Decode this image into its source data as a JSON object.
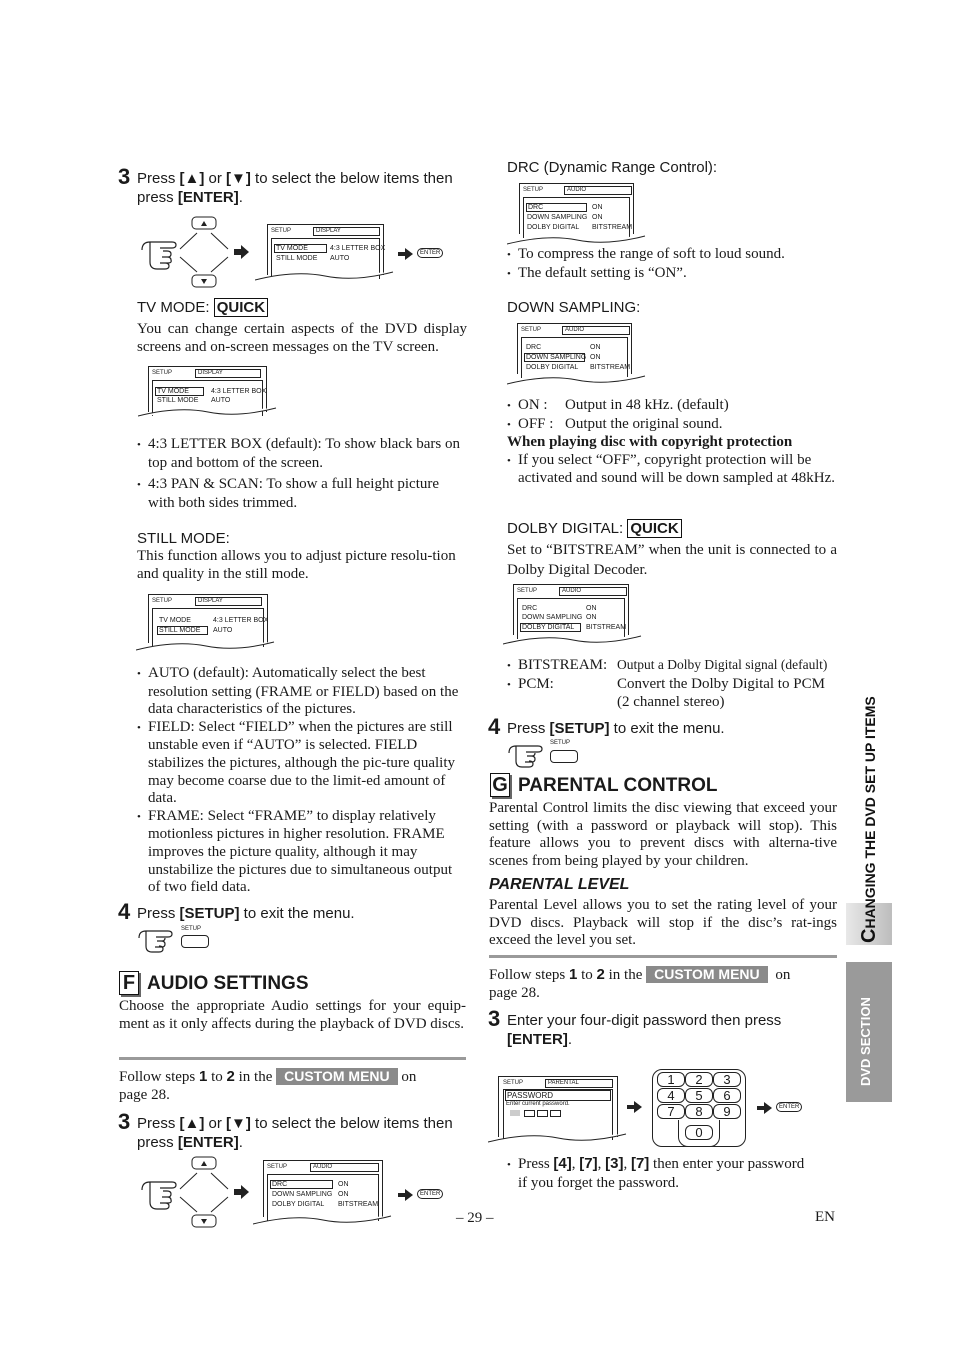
{
  "left_column": {
    "step3_top": {
      "number": "3",
      "text_pre": "Press ",
      "up_key": "[▲]",
      "mid": " or ",
      "down_key": "[▼]",
      "text_post": " to select the below items then",
      "line2_pre": "press ",
      "enter_key": "[ENTER]",
      "line2_post": "."
    },
    "osd_display_1": {
      "setup": "SETUP",
      "tab": "DISPLAY",
      "rows": [
        {
          "label": "TV MODE",
          "value": "4:3 LETTER BOX"
        },
        {
          "label": "STILL MODE",
          "value": "AUTO"
        }
      ],
      "enter_label": "ENTER"
    },
    "tv_mode": {
      "heading": "TV MODE:",
      "badge": "QUICK",
      "description": "You can change certain aspects of the DVD display screens and on-screen messages on the TV screen.",
      "bullets": [
        "4:3 LETTER BOX (default): To show black bars on top and bottom of the screen.",
        "4:3 PAN & SCAN: To show a full height picture with both sides trimmed."
      ]
    },
    "still_mode": {
      "heading": "STILL MODE:",
      "description": "This function allows you to adjust picture resolu-tion and quality in the still mode.",
      "bullets": [
        "AUTO (default): Automatically select the best resolution setting (FRAME or FIELD) based on the data characteristics of the pictures.",
        "FIELD: Select “FIELD” when the pictures are still unstable even if “AUTO” is selected. FIELD stabilizes the pictures, although the pic-ture quality may become coarse due to the limit-ed amount of data.",
        "FRAME: Select “FRAME” to display relatively motionless pictures in higher resolution. FRAME improves the picture quality, although it may unstabilize the pictures due to simultaneous output of two field data."
      ]
    },
    "step4": {
      "number": "4",
      "text_pre": "Press ",
      "key": "[SETUP]",
      "text_post": " to exit the menu.",
      "button_label": "SETUP"
    },
    "audio_settings": {
      "letter": "F",
      "title": "AUDIO SETTINGS",
      "description": "Choose the appropriate Audio settings for your equip-ment as it only affects during the playback of DVD discs.",
      "follow_pre": "Follow steps ",
      "step_from": "1",
      "follow_to": " to ",
      "step_to": "2",
      "follow_in": " in the ",
      "custom_menu": "CUSTOM MENU",
      "follow_post": " on",
      "follow_line2": "page 28."
    },
    "step3_audio": {
      "number": "3",
      "text_pre": "Press ",
      "up_key": "[▲]",
      "mid": " or ",
      "down_key": "[▼]",
      "text_post": " to select the below items then",
      "line2_pre": "press ",
      "enter_key": "[ENTER]",
      "line2_post": "."
    },
    "osd_audio_1": {
      "setup": "SETUP",
      "tab": "AUDIO",
      "rows": [
        {
          "label": "DRC",
          "value": "ON"
        },
        {
          "label": "DOWN SAMPLING",
          "value": "ON"
        },
        {
          "label": "DOLBY DIGITAL",
          "value": "BITSTREAM"
        }
      ],
      "enter_label": "ENTER"
    }
  },
  "right_column": {
    "drc": {
      "heading": "DRC (Dynamic Range Control):",
      "bullets": [
        "To compress the range of soft to loud sound.",
        "The default setting is “ON”."
      ]
    },
    "down_sampling": {
      "heading": "DOWN SAMPLING:",
      "on_label": "ON :",
      "on_text": "Output in 48 kHz. (default)",
      "off_label": "OFF :",
      "off_text": "Output the original sound.",
      "copyright_heading": "When playing disc with copyright protection",
      "copyright_bullet": "If you select “OFF”, copyright protection will be activated and sound will be down sampled at 48kHz."
    },
    "dolby_digital": {
      "heading": "DOLBY DIGITAL:",
      "badge": "QUICK",
      "description": "Set to “BITSTREAM” when the unit is connected to a Dolby Digital Decoder.",
      "bitstream_label": "BITSTREAM:",
      "bitstream_text": "Output a Dolby Digital signal (default)",
      "pcm_label": "PCM:",
      "pcm_text": "Convert the Dolby Digital to PCM",
      "pcm_text2": "(2 channel stereo)"
    },
    "step4": {
      "number": "4",
      "text_pre": "Press ",
      "key": "[SETUP]",
      "text_post": " to exit the menu.",
      "button_label": "SETUP"
    },
    "parental_control": {
      "letter": "G",
      "title": "PARENTAL CONTROL",
      "description": "Parental Control limits the disc viewing that exceed your setting (with a password or playback will stop). This feature allows you to prevent discs with alterna-tive scenes from being played by your children.",
      "level_heading": "PARENTAL LEVEL",
      "level_description": "Parental Level allows you to set the rating level of your DVD discs. Playback will stop if the disc’s rat-ings exceed the level you set.",
      "follow_pre": "Follow steps ",
      "step_from": "1",
      "follow_to": " to ",
      "step_to": "2",
      "follow_in": " in the ",
      "custom_menu": "CUSTOM MENU",
      "follow_post": " on",
      "follow_line2": "page 28."
    },
    "step3_password": {
      "number": "3",
      "text": "Enter your four-digit password then press",
      "key": "[ENTER]",
      "post": "."
    },
    "osd_parental": {
      "setup": "SETUP",
      "tab": "PARENTAL",
      "field": "PASSWORD",
      "prompt": "Enter current password.",
      "enter_label": "ENTER"
    },
    "keypad": [
      "1",
      "2",
      "3",
      "4",
      "5",
      "6",
      "7",
      "8",
      "9",
      "0"
    ],
    "forgot_bullet": {
      "pre": "Press ",
      "k1": "[4]",
      "k2": "[7]",
      "k3": "[3]",
      "k4": "[7]",
      "post": " then enter your password",
      "line2": "if you forget the password."
    }
  },
  "sidebar": {
    "chapter_title_initial": "C",
    "chapter_title_rest": "HANGING THE DVD SET UP ITEMS",
    "section_label": "DVD SECTION"
  },
  "footer": {
    "page_number": "– 29 –",
    "language": "EN"
  }
}
